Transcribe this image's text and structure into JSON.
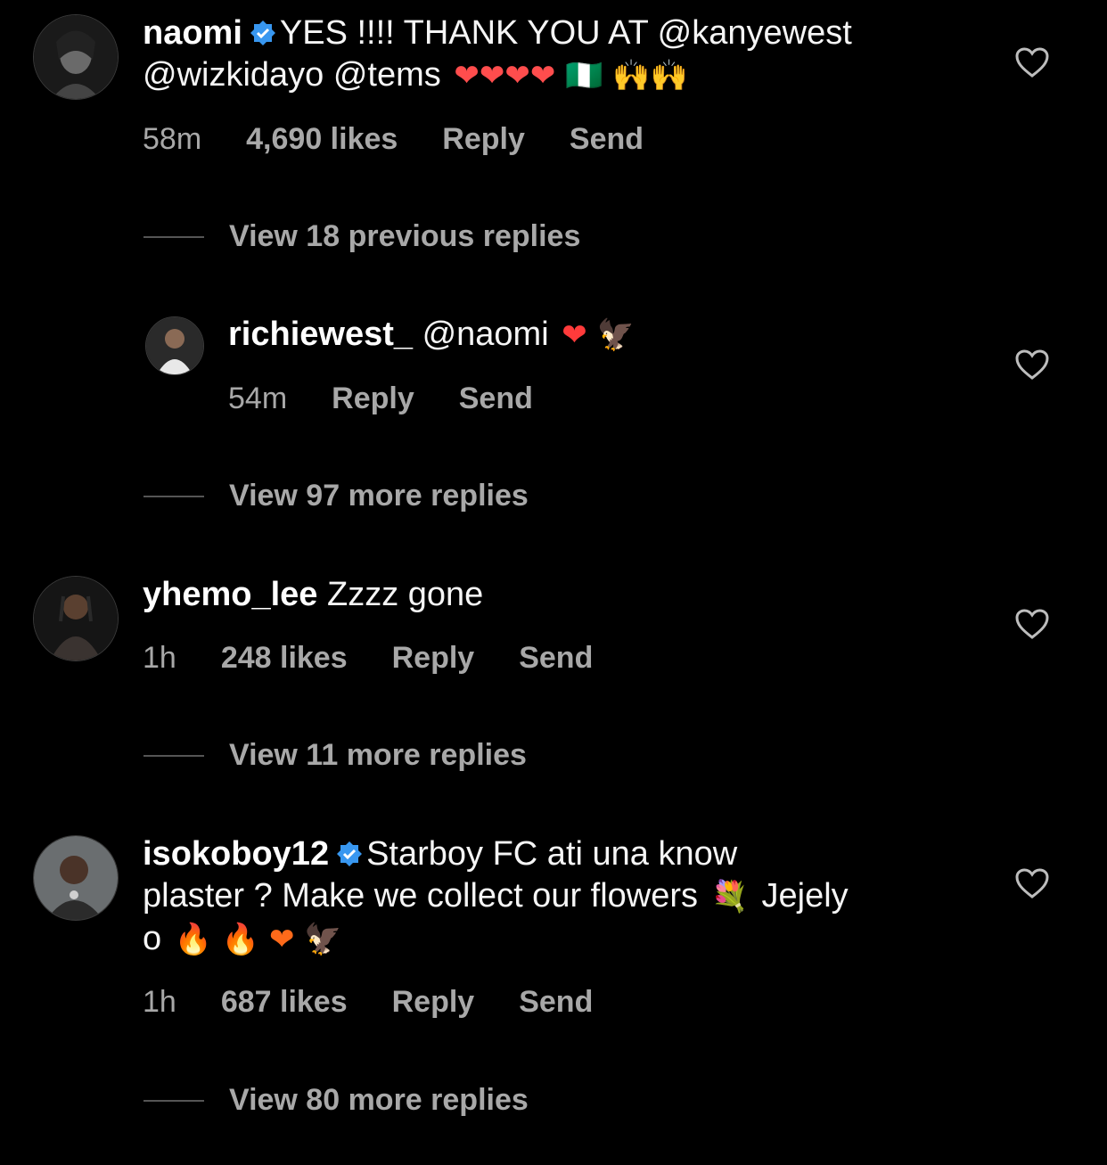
{
  "comments": [
    {
      "username": "naomi",
      "text_line1": "YES !!!! THANK YOU AT @kanyewest",
      "text_line2": "@wizkidayo @tems",
      "emojis": "❤❤❤❤ 🇳🇬 🙌🙌",
      "time": "58m",
      "likes": "4,690 likes",
      "reply_label": "Reply",
      "send_label": "Send",
      "view_replies": "View 18 previous replies"
    },
    {
      "username": "richiewest_",
      "text_line1": "@naomi",
      "emojis": "❤ 🦅",
      "time": "54m",
      "reply_label": "Reply",
      "send_label": "Send",
      "view_replies": "View 97 more replies"
    },
    {
      "username": "yhemo_lee",
      "text_line1": "Zzzz gone",
      "time": "1h",
      "likes": "248 likes",
      "reply_label": "Reply",
      "send_label": "Send",
      "view_replies": "View 11 more replies"
    },
    {
      "username": "isokoboy12",
      "text_line1": "Starboy FC ati una know",
      "text_line2": "plaster ? Make we collect our flowers",
      "text_line2b": "Jejely",
      "text_line3": "o",
      "emojis_line2": "💐",
      "emojis_line3": "🔥 🔥 ❤ 🦅",
      "time": "1h",
      "likes": "687 likes",
      "reply_label": "Reply",
      "send_label": "Send",
      "view_replies": "View 80 more replies"
    }
  ],
  "colors": {
    "background": "#000000",
    "meta": "#a8a8a8",
    "verified": "#3897f0"
  }
}
